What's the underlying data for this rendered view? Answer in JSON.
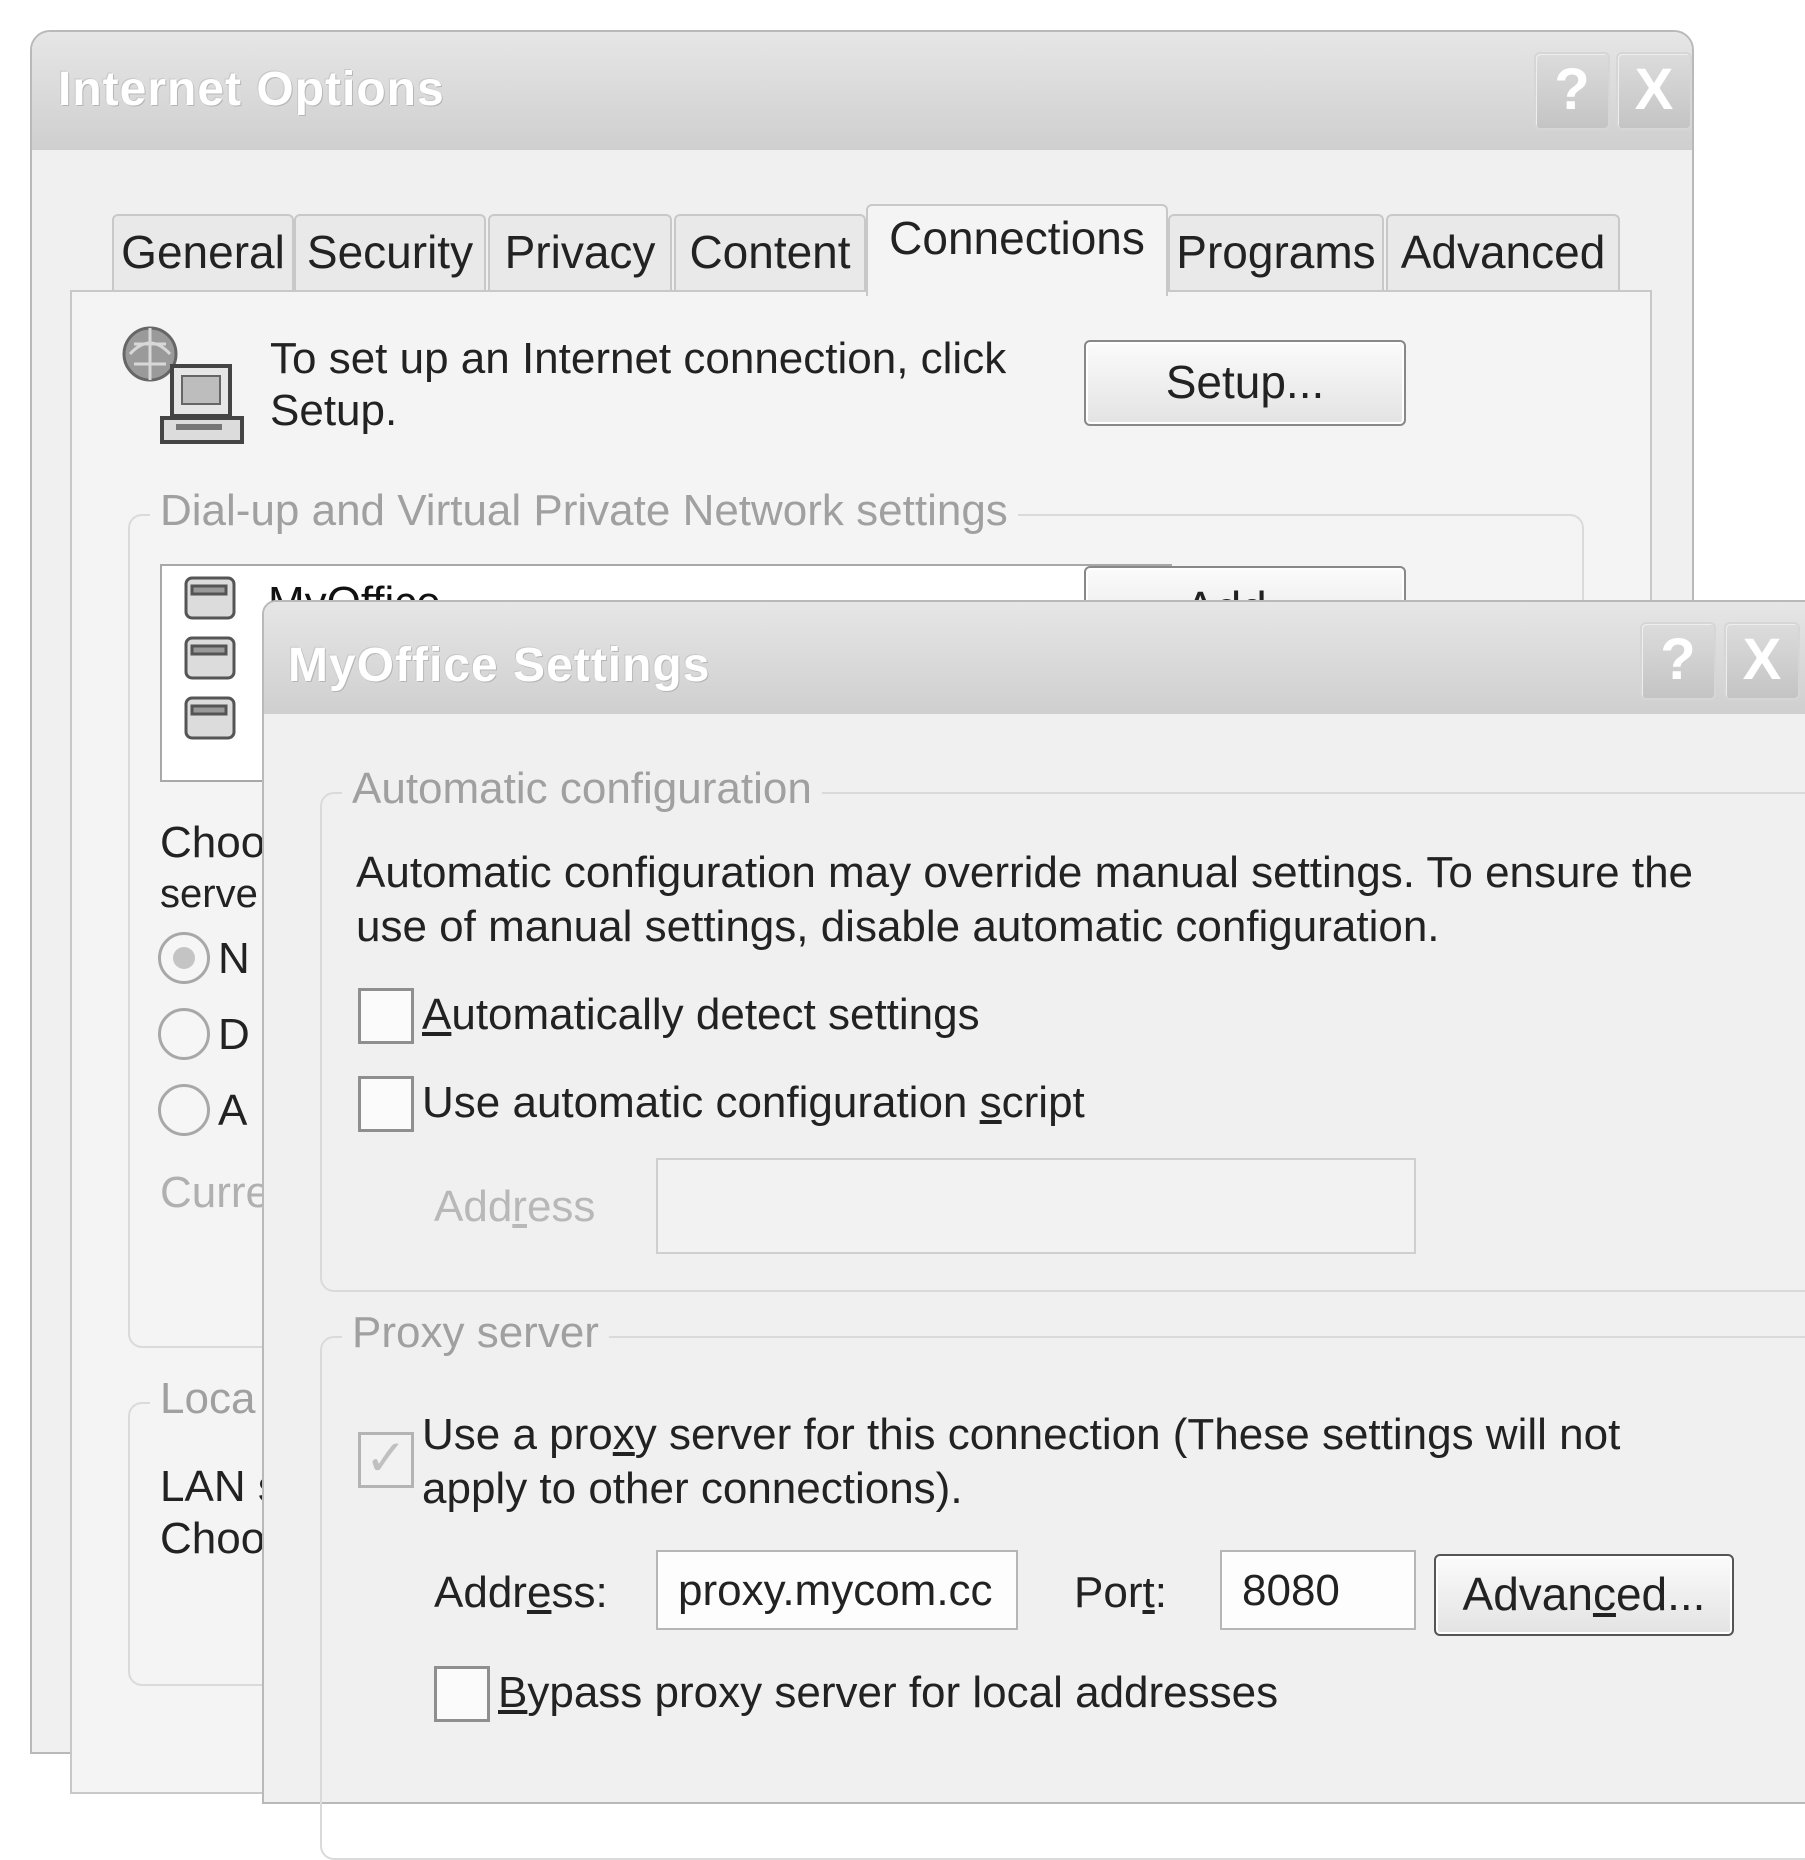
{
  "main": {
    "title": "Internet Options",
    "help_glyph": "?",
    "close_glyph": "X",
    "tabs": [
      {
        "label": "General"
      },
      {
        "label": "Security"
      },
      {
        "label": "Privacy"
      },
      {
        "label": "Content"
      },
      {
        "label": "Connections",
        "active": true
      },
      {
        "label": "Programs"
      },
      {
        "label": "Advanced"
      }
    ],
    "setup_text_line1": "To set up an Internet connection, click",
    "setup_text_line2": "Setup.",
    "setup_button": "Setup...",
    "dialup_group_label": "Dial-up and Virtual Private Network settings",
    "connections": [
      {
        "name": "MyOffice"
      }
    ],
    "add_button": "Add...",
    "choose_text_line1": "Choo",
    "choose_text_line2": "serve",
    "radio_options": [
      {
        "label": "N",
        "selected": true
      },
      {
        "label": "D",
        "selected": false
      },
      {
        "label": "A",
        "selected": false
      }
    ],
    "current_label": "Curre",
    "lan_group_label": "Loca",
    "lan_text_line1": "LAN s",
    "lan_text_line2": "Choo",
    "icons": [
      "network-connection-icon",
      "dialup-connection-icon"
    ]
  },
  "settings": {
    "title": "MyOffice Settings",
    "help_glyph": "?",
    "close_glyph": "X",
    "auto_group_label": "Automatic configuration",
    "auto_desc_line1": "Automatic configuration may override manual settings.  To ensure the",
    "auto_desc_line2": "use of manual settings, disable automatic configuration.",
    "auto_detect": {
      "label_first": "A",
      "label_rest": "utomatically detect settings",
      "checked": false
    },
    "auto_script": {
      "label_pre": "Use automatic configuration ",
      "label_key": "s",
      "label_post": "cript",
      "checked": false
    },
    "script_address": {
      "label_pre": "Add",
      "label_key": "r",
      "label_post": "ess",
      "value": ""
    },
    "proxy_group_label": "Proxy server",
    "use_proxy": {
      "line1_pre": "Use a pro",
      "line1_key": "x",
      "line1_post": "y server for this connection (These settings will not",
      "line2": "apply to other connections).",
      "checked": true
    },
    "proxy_address": {
      "label_pre": "Addr",
      "label_key": "e",
      "label_post": "ss:",
      "value": "proxy.mycom.cc"
    },
    "proxy_port": {
      "label_pre": "Por",
      "label_key": "t",
      "label_post": ":",
      "value": "8080"
    },
    "advanced_button": {
      "pre": "Advan",
      "key": "c",
      "post": "ed..."
    },
    "bypass": {
      "key": "B",
      "rest": "ypass proxy server for local addresses",
      "checked": false
    }
  }
}
